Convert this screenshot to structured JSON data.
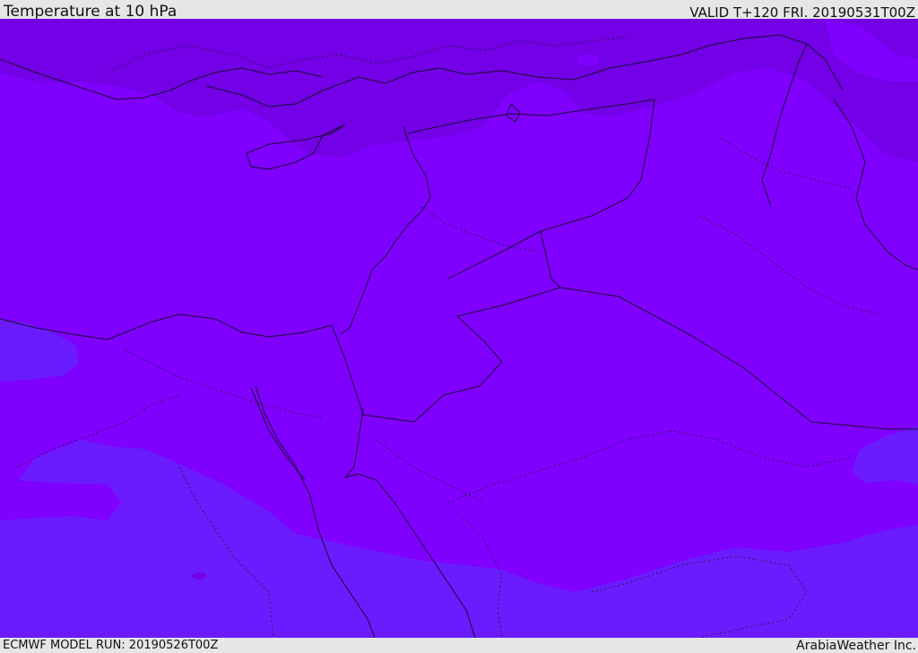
{
  "header": {
    "title": "Temperature at 10 hPa",
    "valid": "VALID T+120 FRI. 20190531T00Z"
  },
  "footer": {
    "model_run": "ECMWF MODEL RUN: 20190526T00Z",
    "credit": "ArabiaWeather Inc."
  },
  "colors": {
    "band_warm": "#8000ff",
    "band_cool": "#7300e6",
    "band_cold": "#6a1cff",
    "bar_background": "#e6e6e6",
    "line": "#1a0a33"
  }
}
